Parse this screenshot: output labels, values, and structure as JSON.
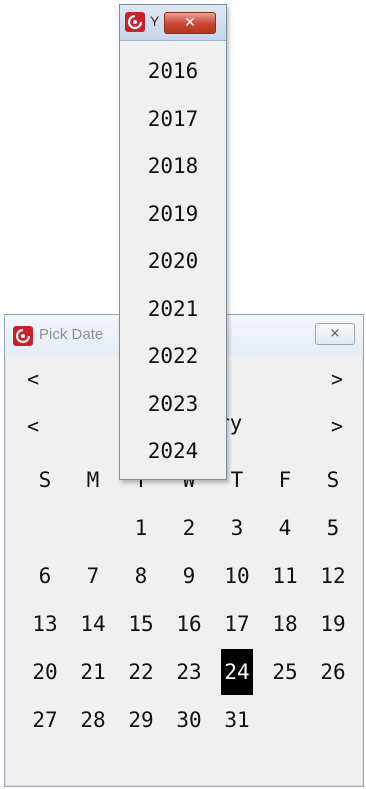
{
  "pick_window": {
    "title": "Pick Date",
    "close_symbol": "⨯",
    "icon": "app-logo-icon",
    "year_prev": "<",
    "year_next": ">",
    "month_prev": "<",
    "month_next": ">",
    "month_partial": "ry"
  },
  "calendar": {
    "weekdays": [
      "S",
      "M",
      "T",
      "W",
      "T",
      "F",
      "S"
    ],
    "leading_blanks": 2,
    "days_in_month": 31,
    "selected_day": 24,
    "selected_bg": "#000000",
    "selected_fg": "#ffffff"
  },
  "year_popup": {
    "title": "Y",
    "close_symbol": "✕",
    "icon": "app-logo-icon",
    "years": [
      "2016",
      "2017",
      "2018",
      "2019",
      "2020",
      "2021",
      "2022",
      "2023",
      "2024"
    ]
  },
  "colors": {
    "app_icon": "#cc1f2a",
    "popup_close": "#c8452f",
    "window_bg": "#f0f0f0"
  }
}
